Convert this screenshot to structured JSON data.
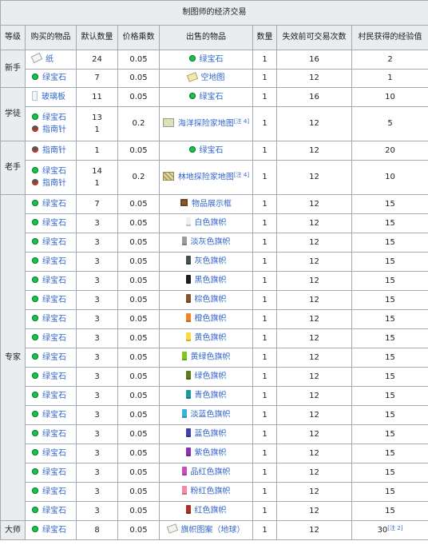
{
  "table": {
    "title": "制图师的经济交易",
    "headers": [
      "等级",
      "购买的物品",
      "默认数量",
      "价格乘数",
      "出售的物品",
      "数量",
      "失效前可交易次数",
      "村民获得的经验值"
    ],
    "rows": [
      {
        "level": "新手",
        "level_rowspan": 2,
        "buy": [
          {
            "icon": "paper-icon",
            "name": "纸",
            "qty": "24"
          }
        ],
        "mult": "0.05",
        "sell": {
          "icon": "emerald-icon",
          "name": "绿宝石",
          "note": ""
        },
        "qty": "1",
        "uses": "16",
        "xp": "2",
        "xp_note": ""
      },
      {
        "buy": [
          {
            "icon": "emerald-icon",
            "name": "绿宝石",
            "qty": "7"
          }
        ],
        "mult": "0.05",
        "sell": {
          "icon": "empty-map-icon",
          "name": "空地图",
          "note": ""
        },
        "qty": "1",
        "uses": "12",
        "xp": "1",
        "xp_note": ""
      },
      {
        "level": "学徒",
        "level_rowspan": 2,
        "buy": [
          {
            "icon": "glass-pane-icon",
            "name": "玻璃板",
            "qty": "11"
          }
        ],
        "mult": "0.05",
        "sell": {
          "icon": "emerald-icon",
          "name": "绿宝石",
          "note": ""
        },
        "qty": "1",
        "uses": "16",
        "xp": "10",
        "xp_note": ""
      },
      {
        "buy": [
          {
            "icon": "emerald-icon",
            "name": "绿宝石",
            "qty": "13"
          },
          {
            "icon": "compass-icon",
            "name": "指南针",
            "qty": "1"
          }
        ],
        "mult": "0.2",
        "sell": {
          "icon": "ocean-explorer-map-icon",
          "name": "海洋探险家地图",
          "note": "[注 4]"
        },
        "qty": "1",
        "uses": "12",
        "xp": "5",
        "xp_note": ""
      },
      {
        "level": "老手",
        "level_rowspan": 2,
        "buy": [
          {
            "icon": "compass-icon",
            "name": "指南针",
            "qty": "1"
          }
        ],
        "mult": "0.05",
        "sell": {
          "icon": "emerald-icon",
          "name": "绿宝石",
          "note": ""
        },
        "qty": "1",
        "uses": "12",
        "xp": "20",
        "xp_note": ""
      },
      {
        "buy": [
          {
            "icon": "emerald-icon",
            "name": "绿宝石",
            "qty": "14"
          },
          {
            "icon": "compass-icon",
            "name": "指南针",
            "qty": "1"
          }
        ],
        "mult": "0.2",
        "sell": {
          "icon": "woodland-explorer-map-icon",
          "name": "林地探险家地图",
          "note": "[注 4]"
        },
        "qty": "1",
        "uses": "12",
        "xp": "10",
        "xp_note": ""
      },
      {
        "level": "专家",
        "level_rowspan": 17,
        "buy": [
          {
            "icon": "emerald-icon",
            "name": "绿宝石",
            "qty": "7"
          }
        ],
        "mult": "0.05",
        "sell": {
          "icon": "item-frame-icon",
          "name": "物品展示框",
          "note": ""
        },
        "qty": "1",
        "uses": "12",
        "xp": "15",
        "xp_note": ""
      },
      {
        "buy": [
          {
            "icon": "emerald-icon",
            "name": "绿宝石",
            "qty": "3"
          }
        ],
        "mult": "0.05",
        "sell": {
          "icon": "white-banner-icon",
          "name": "白色旗帜",
          "note": ""
        },
        "qty": "1",
        "uses": "12",
        "xp": "15",
        "xp_note": ""
      },
      {
        "buy": [
          {
            "icon": "emerald-icon",
            "name": "绿宝石",
            "qty": "3"
          }
        ],
        "mult": "0.05",
        "sell": {
          "icon": "light-gray-banner-icon",
          "name": "淡灰色旗帜",
          "note": ""
        },
        "qty": "1",
        "uses": "12",
        "xp": "15",
        "xp_note": ""
      },
      {
        "buy": [
          {
            "icon": "emerald-icon",
            "name": "绿宝石",
            "qty": "3"
          }
        ],
        "mult": "0.05",
        "sell": {
          "icon": "gray-banner-icon",
          "name": "灰色旗帜",
          "note": ""
        },
        "qty": "1",
        "uses": "12",
        "xp": "15",
        "xp_note": ""
      },
      {
        "buy": [
          {
            "icon": "emerald-icon",
            "name": "绿宝石",
            "qty": "3"
          }
        ],
        "mult": "0.05",
        "sell": {
          "icon": "black-banner-icon",
          "name": "黑色旗帜",
          "note": ""
        },
        "qty": "1",
        "uses": "12",
        "xp": "15",
        "xp_note": ""
      },
      {
        "buy": [
          {
            "icon": "emerald-icon",
            "name": "绿宝石",
            "qty": "3"
          }
        ],
        "mult": "0.05",
        "sell": {
          "icon": "brown-banner-icon",
          "name": "棕色旗帜",
          "note": ""
        },
        "qty": "1",
        "uses": "12",
        "xp": "15",
        "xp_note": ""
      },
      {
        "buy": [
          {
            "icon": "emerald-icon",
            "name": "绿宝石",
            "qty": "3"
          }
        ],
        "mult": "0.05",
        "sell": {
          "icon": "orange-banner-icon",
          "name": "橙色旗帜",
          "note": ""
        },
        "qty": "1",
        "uses": "12",
        "xp": "15",
        "xp_note": ""
      },
      {
        "buy": [
          {
            "icon": "emerald-icon",
            "name": "绿宝石",
            "qty": "3"
          }
        ],
        "mult": "0.05",
        "sell": {
          "icon": "yellow-banner-icon",
          "name": "黄色旗帜",
          "note": ""
        },
        "qty": "1",
        "uses": "12",
        "xp": "15",
        "xp_note": ""
      },
      {
        "buy": [
          {
            "icon": "emerald-icon",
            "name": "绿宝石",
            "qty": "3"
          }
        ],
        "mult": "0.05",
        "sell": {
          "icon": "lime-banner-icon",
          "name": "黄绿色旗帜",
          "note": ""
        },
        "qty": "1",
        "uses": "12",
        "xp": "15",
        "xp_note": ""
      },
      {
        "buy": [
          {
            "icon": "emerald-icon",
            "name": "绿宝石",
            "qty": "3"
          }
        ],
        "mult": "0.05",
        "sell": {
          "icon": "green-banner-icon",
          "name": "绿色旗帜",
          "note": ""
        },
        "qty": "1",
        "uses": "12",
        "xp": "15",
        "xp_note": ""
      },
      {
        "buy": [
          {
            "icon": "emerald-icon",
            "name": "绿宝石",
            "qty": "3"
          }
        ],
        "mult": "0.05",
        "sell": {
          "icon": "cyan-banner-icon",
          "name": "青色旗帜",
          "note": ""
        },
        "qty": "1",
        "uses": "12",
        "xp": "15",
        "xp_note": ""
      },
      {
        "buy": [
          {
            "icon": "emerald-icon",
            "name": "绿宝石",
            "qty": "3"
          }
        ],
        "mult": "0.05",
        "sell": {
          "icon": "light-blue-banner-icon",
          "name": "淡蓝色旗帜",
          "note": ""
        },
        "qty": "1",
        "uses": "12",
        "xp": "15",
        "xp_note": ""
      },
      {
        "buy": [
          {
            "icon": "emerald-icon",
            "name": "绿宝石",
            "qty": "3"
          }
        ],
        "mult": "0.05",
        "sell": {
          "icon": "blue-banner-icon",
          "name": "蓝色旗帜",
          "note": ""
        },
        "qty": "1",
        "uses": "12",
        "xp": "15",
        "xp_note": ""
      },
      {
        "buy": [
          {
            "icon": "emerald-icon",
            "name": "绿宝石",
            "qty": "3"
          }
        ],
        "mult": "0.05",
        "sell": {
          "icon": "purple-banner-icon",
          "name": "紫色旗帜",
          "note": ""
        },
        "qty": "1",
        "uses": "12",
        "xp": "15",
        "xp_note": ""
      },
      {
        "buy": [
          {
            "icon": "emerald-icon",
            "name": "绿宝石",
            "qty": "3"
          }
        ],
        "mult": "0.05",
        "sell": {
          "icon": "magenta-banner-icon",
          "name": "品红色旗帜",
          "note": ""
        },
        "qty": "1",
        "uses": "12",
        "xp": "15",
        "xp_note": ""
      },
      {
        "buy": [
          {
            "icon": "emerald-icon",
            "name": "绿宝石",
            "qty": "3"
          }
        ],
        "mult": "0.05",
        "sell": {
          "icon": "pink-banner-icon",
          "name": "粉红色旗帜",
          "note": ""
        },
        "qty": "1",
        "uses": "12",
        "xp": "15",
        "xp_note": ""
      },
      {
        "buy": [
          {
            "icon": "emerald-icon",
            "name": "绿宝石",
            "qty": "3"
          }
        ],
        "mult": "0.05",
        "sell": {
          "icon": "red-banner-icon",
          "name": "红色旗帜",
          "note": ""
        },
        "qty": "1",
        "uses": "12",
        "xp": "15",
        "xp_note": ""
      },
      {
        "level": "大师",
        "level_rowspan": 1,
        "buy": [
          {
            "icon": "emerald-icon",
            "name": "绿宝石",
            "qty": "8"
          }
        ],
        "mult": "0.05",
        "sell": {
          "icon": "banner-pattern-icon",
          "name": "旗帜图案（地球）",
          "note": ""
        },
        "qty": "1",
        "uses": "12",
        "xp": "30",
        "xp_note": "[注 2]"
      }
    ]
  },
  "colors": {
    "header_bg": "#eaecf0",
    "border": "#a2a9b1",
    "link": "#3366cc",
    "emerald": "#17c24a",
    "banners": {
      "white-banner-icon": "#f0f0f0",
      "light-gray-banner-icon": "#9d9d97",
      "gray-banner-icon": "#474f52",
      "black-banner-icon": "#1d1d21",
      "brown-banner-icon": "#835432",
      "orange-banner-icon": "#f9801d",
      "yellow-banner-icon": "#fed83d",
      "lime-banner-icon": "#80c71f",
      "green-banner-icon": "#5e7c16",
      "cyan-banner-icon": "#169c9c",
      "light-blue-banner-icon": "#3ab3da",
      "blue-banner-icon": "#3c44aa",
      "purple-banner-icon": "#8932b8",
      "magenta-banner-icon": "#c74ebd",
      "pink-banner-icon": "#f38baa",
      "red-banner-icon": "#b02e26"
    }
  }
}
